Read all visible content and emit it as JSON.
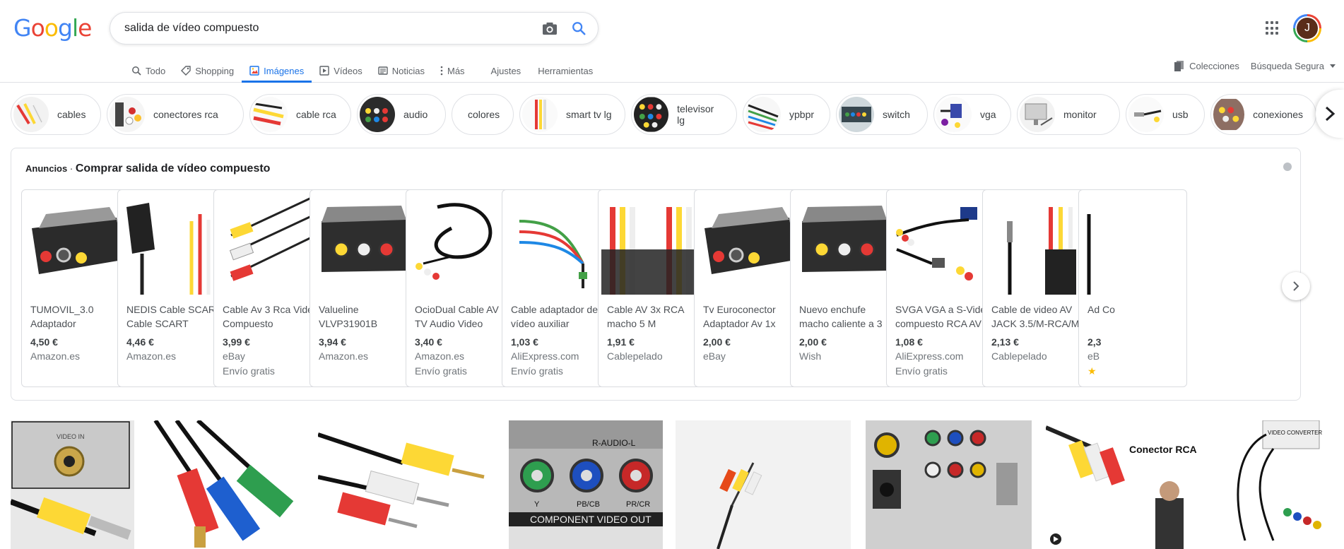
{
  "header": {
    "logo": [
      "G",
      "o",
      "o",
      "g",
      "l",
      "e"
    ],
    "logo_colors": [
      "#4285f4",
      "#ea4335",
      "#fbbc05",
      "#4285f4",
      "#34a853",
      "#ea4335"
    ],
    "query": "salida de vídeo compuesto",
    "avatar_letter": "J"
  },
  "tabs": [
    {
      "label": "Todo",
      "icon": "search-icon"
    },
    {
      "label": "Shopping",
      "icon": "tag-icon"
    },
    {
      "label": "Imágenes",
      "icon": "image-icon",
      "active": true
    },
    {
      "label": "Vídeos",
      "icon": "play-icon"
    },
    {
      "label": "Noticias",
      "icon": "news-icon"
    },
    {
      "label": "Más",
      "icon": "more-icon"
    },
    {
      "label": "Ajustes"
    },
    {
      "label": "Herramientas"
    }
  ],
  "right_tools": {
    "collections": "Colecciones",
    "safe_search": "Búsqueda Segura"
  },
  "chips": [
    {
      "label": "cables"
    },
    {
      "label": "conectores rca"
    },
    {
      "label": "cable rca"
    },
    {
      "label": "audio"
    },
    {
      "label": "colores"
    },
    {
      "label": "smart tv lg"
    },
    {
      "label": "televisor lg"
    },
    {
      "label": "ypbpr"
    },
    {
      "label": "switch"
    },
    {
      "label": "vga"
    },
    {
      "label": "monitor"
    },
    {
      "label": "usb"
    },
    {
      "label": "conexiones"
    }
  ],
  "ads": {
    "label": "Anuncios",
    "separator": "·",
    "title": "Comprar salida de vídeo compuesto",
    "products": [
      {
        "title": "TUMOVIL_3.0 Adaptador",
        "price": "4,50 €",
        "store": "Amazon.es",
        "extra": ""
      },
      {
        "title": "NEDIS Cable SCART Cable SCART",
        "price": "4,46 €",
        "store": "Amazon.es",
        "extra": ""
      },
      {
        "title": "Cable Av 3 Rca Video Compuesto",
        "price": "3,99 €",
        "store": "eBay",
        "extra": "Envío gratis"
      },
      {
        "title": "Valueline VLVP31901B",
        "price": "3,94 €",
        "store": "Amazon.es",
        "extra": ""
      },
      {
        "title": "OcioDual Cable AV TV Audio Video",
        "price": "3,40 €",
        "store": "Amazon.es",
        "extra": "Envío gratis"
      },
      {
        "title": "Cable adaptador de vídeo auxiliar",
        "price": "1,03 €",
        "store": "AliExpress.com",
        "extra": "Envío gratis"
      },
      {
        "title": "Cable AV 3x RCA macho 5 M",
        "price": "1,91 €",
        "store": "Cablepelado",
        "extra": ""
      },
      {
        "title": "Tv Euroconector Adaptador Av 1x",
        "price": "2,00 €",
        "store": "eBay",
        "extra": ""
      },
      {
        "title": "Nuevo enchufe macho caliente a 3",
        "price": "2,00 €",
        "store": "Wish",
        "extra": ""
      },
      {
        "title": "SVGA VGA a S-Video compuesto RCA AV",
        "price": "1,08 €",
        "store": "AliExpress.com",
        "extra": "Envío gratis"
      },
      {
        "title": "Cable de video AV JACK 3.5/M-RCA/M",
        "price": "2,13 €",
        "store": "Cablepelado",
        "extra": ""
      },
      {
        "title": "Ad Co",
        "price": "2,3",
        "store": "eB",
        "extra": "★"
      }
    ]
  },
  "image_text": {
    "video_in": "VIDEO IN",
    "r_audio_l": "R-AUDIO-L",
    "component": "COMPONENT VIDEO OUT",
    "y": "Y",
    "pb": "PB/CB",
    "pr": "PR/CR",
    "conector_rca": "Conector RCA",
    "video_converter": "VIDEO CONVERTER"
  }
}
